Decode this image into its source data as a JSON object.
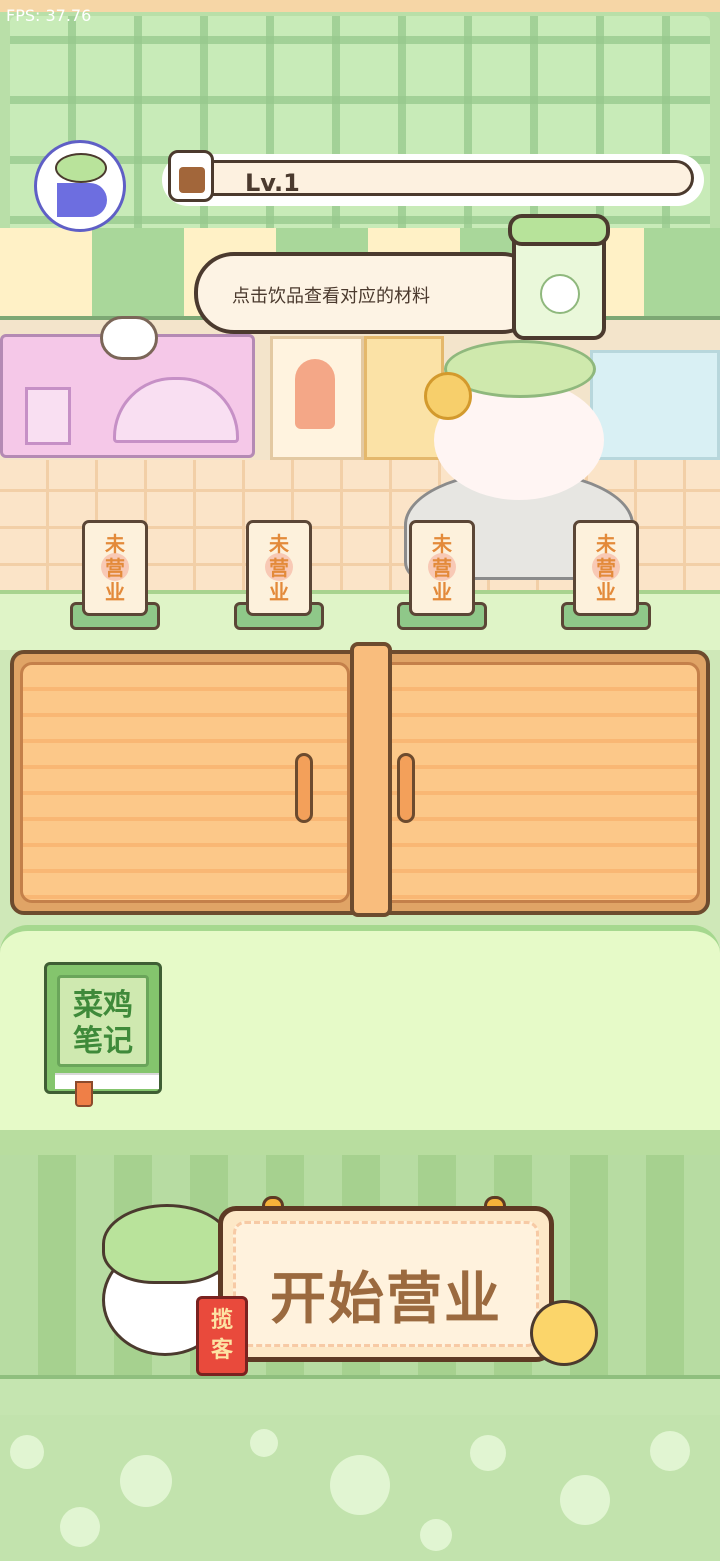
{
  "hud": {
    "fps": "FPS: 37.76",
    "level": "Lv.1"
  },
  "hint": {
    "text": "点击饮品查看对应的材料"
  },
  "plaques": [
    {
      "text": "未营业"
    },
    {
      "text": "未营业"
    },
    {
      "text": "未营业"
    },
    {
      "text": "未营业"
    }
  ],
  "notebook": {
    "line1": "菜鸡",
    "line2": "笔记"
  },
  "start": {
    "label": "开始营业",
    "tag_line1": "揽",
    "tag_line2": "客"
  },
  "icons": {
    "avatar": "leaf-chick-avatar-icon",
    "level": "milk-tea-cup-icon",
    "hint_drink": "matcha-drink-icon",
    "pointer": "pointing-hand-icon"
  },
  "colors": {
    "wall_green": "#b9dfa8",
    "cabinet_orange": "#f9b774",
    "shelf_green": "#e6fac8",
    "text_brown": "#4b3a2e",
    "start_text": "#9b6a3f"
  }
}
